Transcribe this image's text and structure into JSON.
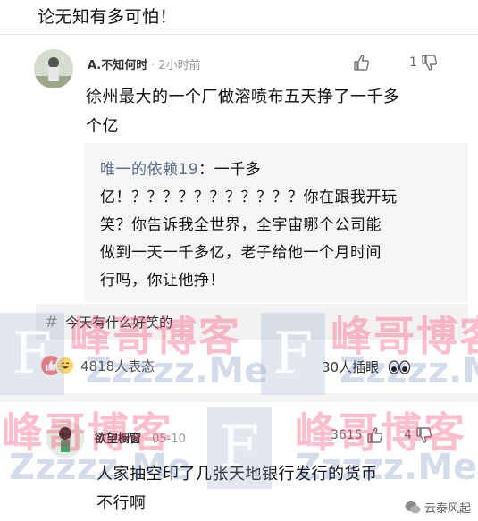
{
  "top_text": "论无知有多可怕！",
  "comment1": {
    "username": "A.不知何时",
    "time": "2小时前",
    "down_count": "1",
    "text_lines": [
      "徐州最大的一个厂做溶喷布五天挣了一千多",
      "个亿"
    ]
  },
  "reply": {
    "username": "唯一的依赖19",
    "first": "：一千多",
    "lines": [
      "亿！？？？？？？？？？？？你在跟我开玩",
      "笑？你告诉我全世界，全宇宙哪个公司能",
      "做到一天一千多亿，老子给他一个月时间",
      "行吗，你让他挣！"
    ]
  },
  "topic": {
    "hash": "#",
    "label": "今天有什么好笑的"
  },
  "reactions": {
    "count_label": "4818人表态",
    "insert_label": "30人插眼"
  },
  "comment2": {
    "username": "欲望橱窗",
    "time": "05-10",
    "up_count": "3615",
    "down_count": "4",
    "text_lines": [
      "人家抽空印了几张天地银行发行的货币",
      "不行啊"
    ]
  },
  "watermark": {
    "cn": "峰哥博客",
    "en": "Zzzzz.Me",
    "letter": "F"
  },
  "brand": {
    "label": "云泰风起"
  },
  "colors": {
    "quote_user": "#5a6c8c",
    "watermark_pink": "#ff285a",
    "watermark_blue": "#3c5aa0"
  }
}
